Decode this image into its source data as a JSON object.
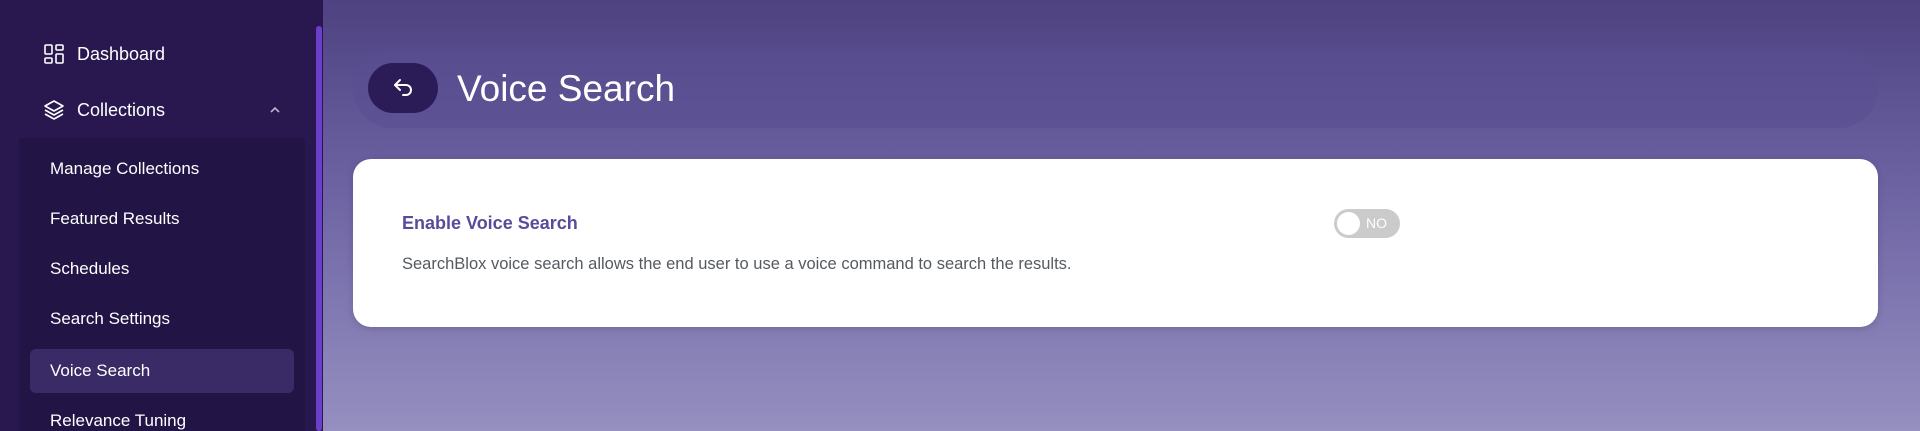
{
  "sidebar": {
    "dashboard_label": "Dashboard",
    "collections_label": "Collections",
    "submenu": [
      {
        "label": "Manage Collections"
      },
      {
        "label": "Featured Results"
      },
      {
        "label": "Schedules"
      },
      {
        "label": "Search Settings"
      },
      {
        "label": "Voice Search"
      },
      {
        "label": "Relevance Tuning"
      }
    ],
    "active_item": "Voice Search"
  },
  "header": {
    "title": "Voice Search",
    "back_icon": "back-arrow-icon"
  },
  "settings": {
    "voice_search": {
      "label": "Enable Voice Search",
      "toggle_text": "NO",
      "enabled": false,
      "description": "SearchBlox voice search allows the end user to use a voice command to search the results."
    }
  },
  "colors": {
    "sidebar_bg": "#28184f",
    "accent": "#6a40c8",
    "label_purple": "#5b4a9a",
    "toggle_off": "#cbcbcb"
  }
}
